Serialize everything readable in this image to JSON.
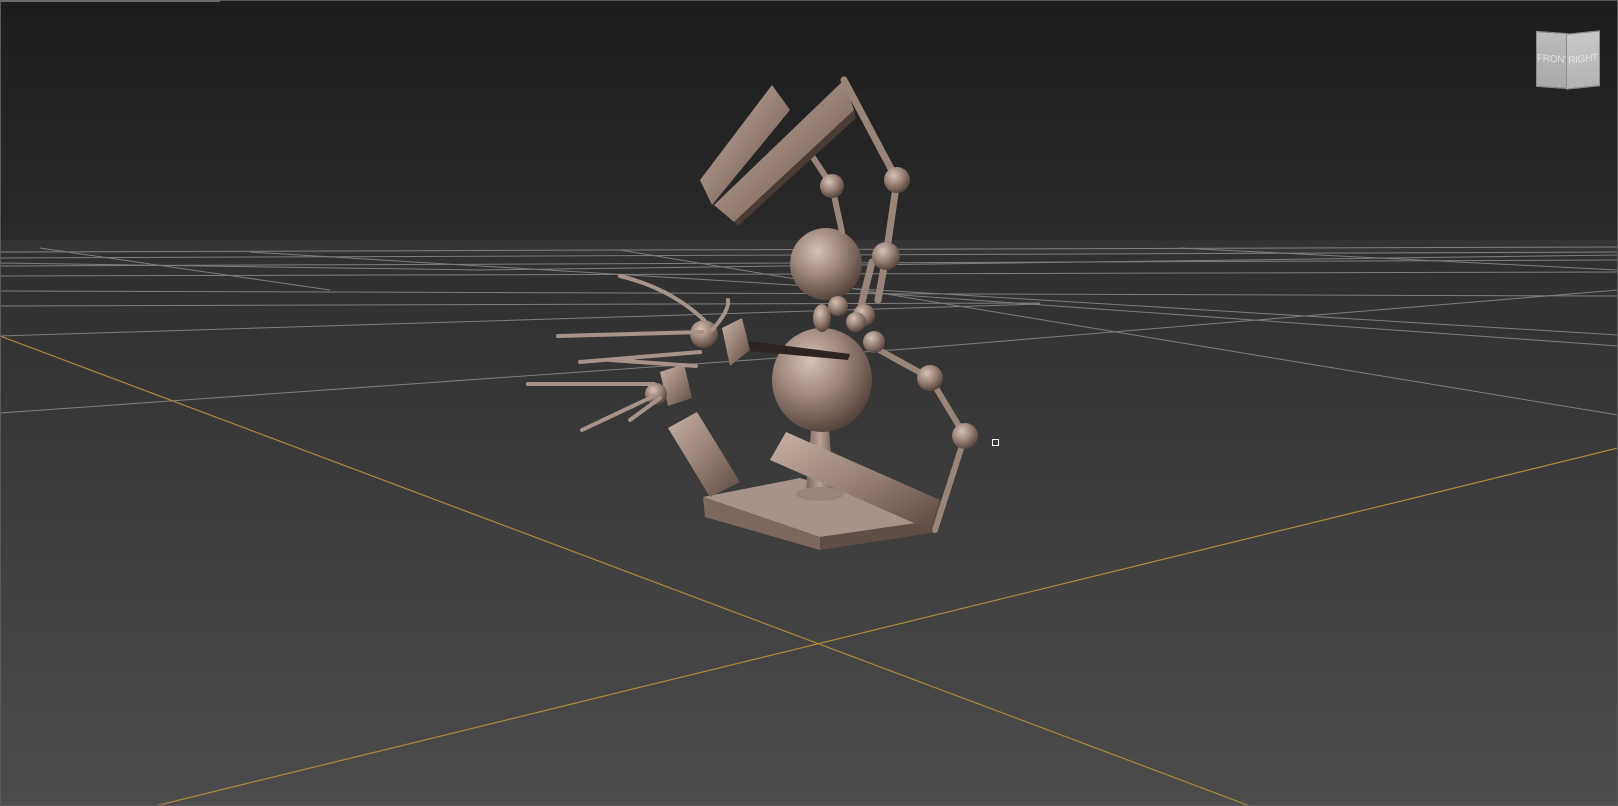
{
  "viewport": {
    "name": "perspective-viewport",
    "background_top": "#1c1c1c",
    "background_bottom": "#4a4a4a"
  },
  "grid": {
    "line_color": "#8a8a8a",
    "axis_color": "#b08a3a"
  },
  "model": {
    "material_color": "#a08a80",
    "shadow_color": "#4b3b35",
    "highlight_color": "#d8c4ba"
  },
  "viewcube": {
    "front_label": "FRONT",
    "right_label": "RIGHT"
  }
}
